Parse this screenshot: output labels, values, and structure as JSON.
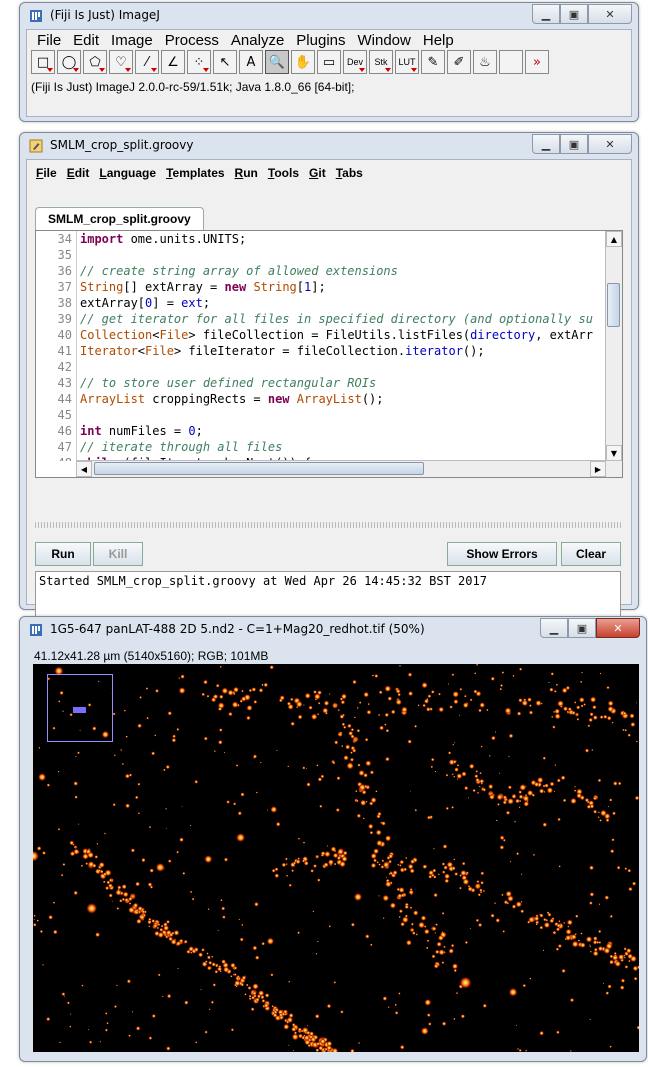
{
  "imagej": {
    "title": "(Fiji Is Just) ImageJ",
    "menu": [
      "File",
      "Edit",
      "Image",
      "Process",
      "Analyze",
      "Plugins",
      "Window",
      "Help"
    ],
    "tools": [
      {
        "name": "rectangle-tool",
        "glyph": "□"
      },
      {
        "name": "oval-tool",
        "glyph": "◯"
      },
      {
        "name": "polygon-tool",
        "glyph": "⬠"
      },
      {
        "name": "freehand-tool",
        "glyph": "♡"
      },
      {
        "name": "line-tool",
        "glyph": "⁄"
      },
      {
        "name": "angle-tool",
        "glyph": "∠"
      },
      {
        "name": "point-tool",
        "glyph": "⁘"
      },
      {
        "name": "wand-tool",
        "glyph": "↖"
      },
      {
        "name": "text-tool",
        "glyph": "A"
      },
      {
        "name": "magnifier-tool",
        "glyph": "🔍"
      },
      {
        "name": "hand-tool",
        "glyph": "✋"
      },
      {
        "name": "color-picker-tool",
        "glyph": "▭"
      },
      {
        "name": "dev-tool",
        "glyph": "Dev"
      },
      {
        "name": "stk-tool",
        "glyph": "Stk"
      },
      {
        "name": "lut-tool",
        "glyph": "LUT"
      },
      {
        "name": "pencil-tool",
        "glyph": "✎"
      },
      {
        "name": "brush-tool",
        "glyph": "✐"
      },
      {
        "name": "flood-fill-tool",
        "glyph": "♨"
      },
      {
        "name": "blank-tool",
        "glyph": ""
      },
      {
        "name": "more-tools",
        "glyph": "»"
      }
    ],
    "status": "(Fiji Is Just) ImageJ 2.0.0-rc-59/1.51k; Java 1.8.0_66 [64-bit];"
  },
  "editor": {
    "title": "SMLM_crop_split.groovy",
    "menu": [
      {
        "u": "F",
        "rest": "ile"
      },
      {
        "u": "E",
        "rest": "dit"
      },
      {
        "u": "L",
        "rest": "anguage"
      },
      {
        "u": "T",
        "rest": "emplates"
      },
      {
        "u": "R",
        "rest": "un"
      },
      {
        "u": "T",
        "rest": "ools"
      },
      {
        "u": "G",
        "rest": "it"
      },
      {
        "u": "T",
        "rest": "abs"
      }
    ],
    "tab": "SMLM_crop_split.groovy",
    "code": [
      {
        "n": "34",
        "t": "import ome.units.UNITS;"
      },
      {
        "n": "35",
        "t": ""
      },
      {
        "n": "36",
        "t": "// create string array of allowed extensions"
      },
      {
        "n": "37",
        "t": "String[] extArray = new String[1];"
      },
      {
        "n": "38",
        "t": "extArray[0] = ext;"
      },
      {
        "n": "39",
        "t": "// get iterator for all files in specified directory (and optionally su"
      },
      {
        "n": "40",
        "t": "Collection<File> fileCollection = FileUtils.listFiles(directory, extArr"
      },
      {
        "n": "41",
        "t": "Iterator<File> fileIterator = fileCollection.iterator();"
      },
      {
        "n": "42",
        "t": ""
      },
      {
        "n": "43",
        "t": "// to store user defined rectangular ROIs"
      },
      {
        "n": "44",
        "t": "ArrayList croppingRects = new ArrayList();"
      },
      {
        "n": "45",
        "t": ""
      },
      {
        "n": "46",
        "t": "int numFiles = 0;"
      },
      {
        "n": "47",
        "t": "// iterate through all files"
      },
      {
        "n": "48",
        "t": "while (fileIterator.hasNext()) {"
      }
    ],
    "buttons": {
      "run": "Run",
      "kill": "Kill",
      "show_errors": "Show Errors",
      "clear": "Clear"
    },
    "output": "Started SMLM_crop_split.groovy at Wed Apr 26 14:45:32 BST 2017"
  },
  "image_window": {
    "title": "1G5-647 panLAT-488 2D 5.nd2 - C=1+Mag20_redhot.tif (50%)",
    "info": "41.12x41.28 µm (5140x5160); RGB; 101MB"
  },
  "colors": {
    "accent": "#c00000",
    "window_frame": "#dbe4ee",
    "hot": "#ff9a1a"
  }
}
